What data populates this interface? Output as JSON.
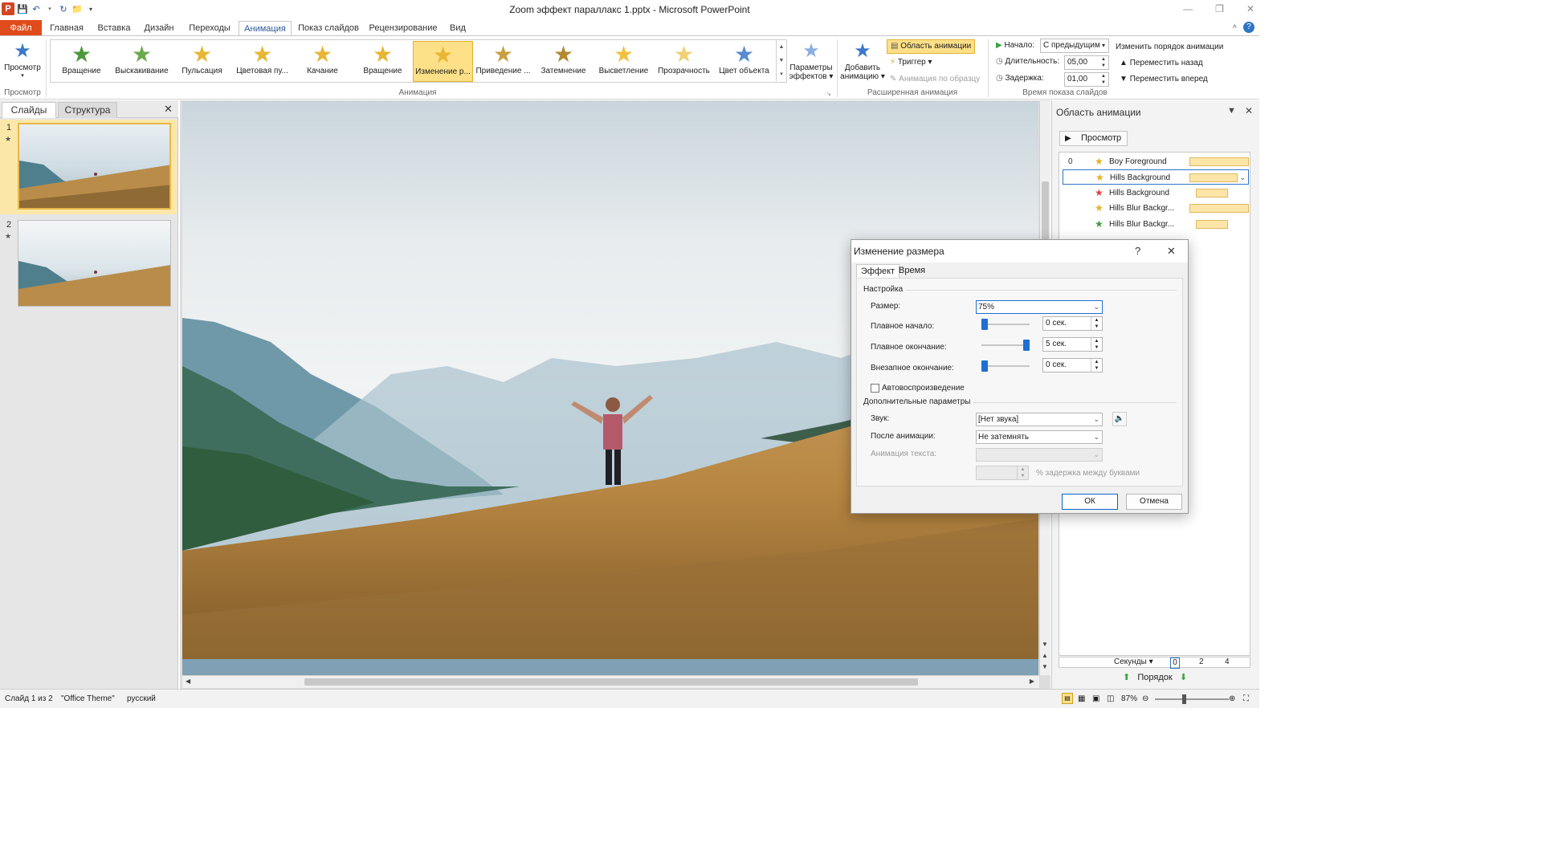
{
  "window": {
    "title": "Zoom эффект параллакс 1.pptx - Microsoft PowerPoint"
  },
  "tabs": [
    "Главная",
    "Вставка",
    "Дизайн",
    "Переходы",
    "Анимация",
    "Показ слайдов",
    "Рецензирование",
    "Вид"
  ],
  "file_tab": "Файл",
  "ribbon": {
    "preview": {
      "label": "Просмотр",
      "group": "Просмотр"
    },
    "gallery": [
      {
        "label": "Вращение",
        "color": "#4a9a3a"
      },
      {
        "label": "Выскакивание",
        "color": "#6aaa4c"
      },
      {
        "label": "Пульсация",
        "color": "#e8b632"
      },
      {
        "label": "Цветовая пу...",
        "color": "#e8b632"
      },
      {
        "label": "Качание",
        "color": "#e8b632"
      },
      {
        "label": "Вращение",
        "color": "#e8b632"
      },
      {
        "label": "Изменение р...",
        "color": "#e8b632"
      },
      {
        "label": "Приведение ...",
        "color": "#c9a040"
      },
      {
        "label": "Затемнение",
        "color": "#b08a30"
      },
      {
        "label": "Высветление",
        "color": "#f0c040"
      },
      {
        "label": "Прозрачность",
        "color": "#f0d070"
      },
      {
        "label": "Цвет объекта",
        "color": "#5a8ad0"
      }
    ],
    "group_animation": "Анимация",
    "effect_params": [
      "Параметры",
      "эффектов ▾"
    ],
    "add_anim": [
      "Добавить",
      "анимацию ▾"
    ],
    "anim_pane_btn": "Область анимации",
    "trigger": "Триггер ▾",
    "anim_painter": "Анимация по образцу",
    "group_ext": "Расширенная анимация",
    "start_label": "Начало:",
    "start_value": "С предыдущим",
    "duration_label": "Длительность:",
    "duration_value": "05,00",
    "delay_label": "Задержка:",
    "delay_value": "01,00",
    "reorder_label": "Изменить порядок анимации",
    "move_back": "Переместить назад",
    "move_fwd": "Переместить вперед",
    "group_timing": "Время показа слайдов"
  },
  "leftpane": {
    "tab_slides": "Слайды",
    "tab_outline": "Структура",
    "slides": [
      "1",
      "2"
    ]
  },
  "animpane": {
    "title": "Область анимации",
    "play": "Просмотр",
    "items": [
      {
        "num": "0",
        "name": "Boy Foreground",
        "icon_color": "#e6b020"
      },
      {
        "num": "",
        "name": "Hills Background",
        "icon_color": "#e6b020"
      },
      {
        "num": "",
        "name": "Hills Background",
        "icon_color": "#e04040"
      },
      {
        "num": "",
        "name": "Hills Blur Backgr...",
        "icon_color": "#e6b020"
      },
      {
        "num": "",
        "name": "Hills Blur Backgr...",
        "icon_color": "#3a9a3a"
      }
    ],
    "timeline_label": "Секунды ▾",
    "ticks": [
      "0",
      "2",
      "4"
    ],
    "order": "Порядок"
  },
  "dialog": {
    "title": "Изменение размера",
    "help": "?",
    "tab_effect": "Эффект",
    "tab_time": "Время",
    "sect_settings": "Настройка",
    "size_label": "Размер:",
    "size_value": "75%",
    "smooth_start_label": "Плавное начало:",
    "smooth_start_value": "0 сек.",
    "smooth_end_label": "Плавное окончание:",
    "smooth_end_value": "5 сек.",
    "bounce_end_label": "Внезапное окончание:",
    "bounce_end_value": "0 сек.",
    "autoreverse": "Автовоспроизведение",
    "sect_extra": "Дополнительные параметры",
    "sound_label": "Звук:",
    "sound_value": "[Нет звука]",
    "after_label": "После анимации:",
    "after_value": "Не затемнять",
    "text_anim_label": "Анимация текста:",
    "letter_delay": "% задержка между буквами",
    "ok": "ОК",
    "cancel": "Отмена"
  },
  "status": {
    "slide": "Слайд 1 из 2",
    "theme": "\"Office Theme\"",
    "lang": "русский",
    "zoom": "87%"
  }
}
